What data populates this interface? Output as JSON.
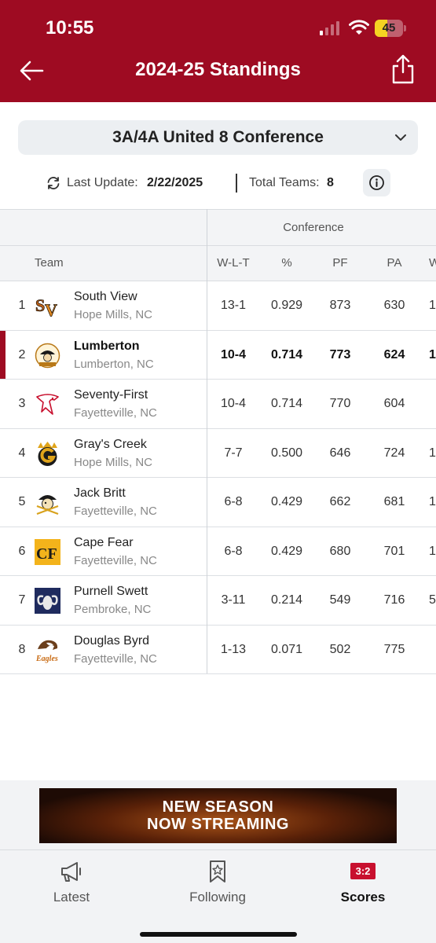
{
  "status_bar": {
    "time": "10:55",
    "battery": "45",
    "battery_level": 0.45
  },
  "header": {
    "title": "2024-25 Standings"
  },
  "conference_select": {
    "value": "3A/4A United 8 Conference"
  },
  "update": {
    "label": "Last Update:",
    "date": "2/22/2025",
    "teams_label": "Total Teams:",
    "teams_count": "8"
  },
  "table": {
    "group_label": "Conference",
    "columns": {
      "team": "Team",
      "wlt": "W-L-T",
      "pct": "%",
      "pf": "PF",
      "pa": "PA",
      "cut": "W"
    },
    "rows": [
      {
        "rank": "1",
        "name": "South View",
        "location": "Hope Mills, NC",
        "wlt": "13-1",
        "pct": "0.929",
        "pf": "873",
        "pa": "630",
        "cut": "1",
        "logo": "south-view-logo"
      },
      {
        "rank": "2",
        "name": "Lumberton",
        "location": "Lumberton, NC",
        "wlt": "10-4",
        "pct": "0.714",
        "pf": "773",
        "pa": "624",
        "cut": "1",
        "logo": "lumberton-pirates-logo"
      },
      {
        "rank": "3",
        "name": "Seventy-First",
        "location": "Fayetteville, NC",
        "wlt": "10-4",
        "pct": "0.714",
        "pf": "770",
        "pa": "604",
        "cut": "",
        "logo": "falcon-logo"
      },
      {
        "rank": "4",
        "name": "Gray's Creek",
        "location": "Hope Mills, NC",
        "wlt": "7-7",
        "pct": "0.500",
        "pf": "646",
        "pa": "724",
        "cut": "1",
        "logo": "grays-creek-g-logo"
      },
      {
        "rank": "5",
        "name": "Jack Britt",
        "location": "Fayetteville, NC",
        "wlt": "6-8",
        "pct": "0.429",
        "pf": "662",
        "pa": "681",
        "cut": "1",
        "logo": "buccaneer-logo"
      },
      {
        "rank": "6",
        "name": "Cape Fear",
        "location": "Fayetteville, NC",
        "wlt": "6-8",
        "pct": "0.429",
        "pf": "680",
        "pa": "701",
        "cut": "1",
        "logo": "cape-fear-cf-logo"
      },
      {
        "rank": "7",
        "name": "Purnell Swett",
        "location": "Pembroke, NC",
        "wlt": "3-11",
        "pct": "0.214",
        "pf": "549",
        "pa": "716",
        "cut": "5",
        "logo": "ram-logo"
      },
      {
        "rank": "8",
        "name": "Douglas Byrd",
        "location": "Fayetteville, NC",
        "wlt": "1-13",
        "pct": "0.071",
        "pf": "502",
        "pa": "775",
        "cut": "",
        "logo": "eagles-logo"
      }
    ]
  },
  "ad": {
    "line1": "NEW SEASON",
    "line2": "NOW STREAMING"
  },
  "tabs": [
    {
      "label": "Latest",
      "icon": "megaphone-icon"
    },
    {
      "label": "Following",
      "icon": "bookmark-star-icon"
    },
    {
      "label": "Scores",
      "icon": "scoreboard-icon",
      "badge": "3:2"
    }
  ],
  "colors": {
    "brand": "#9e0b22",
    "accent_badge": "#c8102e"
  }
}
